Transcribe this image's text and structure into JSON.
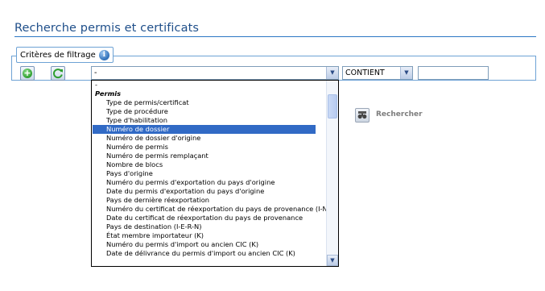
{
  "page": {
    "title": "Recherche permis et certificats"
  },
  "filter": {
    "legend": "Critères de filtrage",
    "info_icon": "i",
    "add_icon": "add-icon",
    "refresh_icon": "refresh-icon",
    "field_select_value": "-",
    "operator_select_value": "CONTIENT",
    "value_input": ""
  },
  "dropdown": {
    "items": [
      {
        "label": "-",
        "kind": "plain"
      },
      {
        "label": "Permis",
        "kind": "group"
      },
      {
        "label": "Type de permis/certificat",
        "kind": "option"
      },
      {
        "label": "Type de procédure",
        "kind": "option"
      },
      {
        "label": "Type d'habilitation",
        "kind": "option"
      },
      {
        "label": "Numéro de dossier",
        "kind": "option",
        "selected": true
      },
      {
        "label": "Numéro de dossier d'origine",
        "kind": "option"
      },
      {
        "label": "Numéro de permis",
        "kind": "option"
      },
      {
        "label": "Numéro de permis remplaçant",
        "kind": "option"
      },
      {
        "label": "Nombre de blocs",
        "kind": "option"
      },
      {
        "label": "Pays d'origine",
        "kind": "option"
      },
      {
        "label": "Numéro du permis d'exportation du pays d'origine",
        "kind": "option"
      },
      {
        "label": "Date du permis d'exportation du pays d'origine",
        "kind": "option"
      },
      {
        "label": "Pays de dernière réexportation",
        "kind": "option"
      },
      {
        "label": "Numéro du certificat de réexportation du pays de provenance (I-N)",
        "kind": "option"
      },
      {
        "label": "Date du certificat de réexportation du pays de provenance",
        "kind": "option"
      },
      {
        "label": "Pays de destination (I-E-R-N)",
        "kind": "option"
      },
      {
        "label": "État membre importateur (K)",
        "kind": "option"
      },
      {
        "label": "Numéro du permis d'import ou ancien CIC (K)",
        "kind": "option"
      },
      {
        "label": "Date de délivrance du permis d'import ou ancien CIC (K)",
        "kind": "option"
      }
    ]
  },
  "search": {
    "label": "Rechercher"
  },
  "colors": {
    "title": "#1f4f8a",
    "rule": "#2b78c4",
    "selection": "#316ac5"
  }
}
